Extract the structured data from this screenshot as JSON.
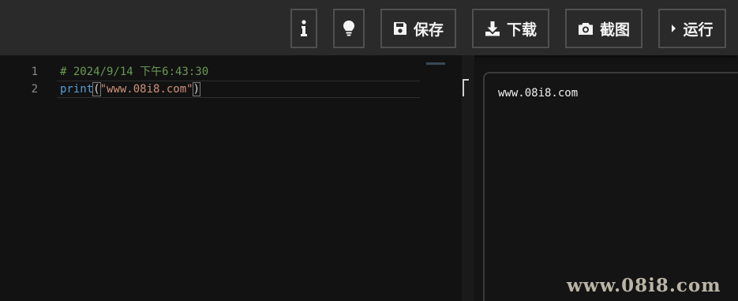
{
  "toolbar": {
    "info_icon": "info-icon",
    "hint_icon": "lightbulb-icon",
    "save_label": "保存",
    "download_label": "下载",
    "screenshot_label": "截图",
    "run_label": "运行"
  },
  "editor": {
    "lines": [
      {
        "number": "1",
        "comment": "# 2024/9/14 下午6:43:30"
      },
      {
        "number": "2",
        "fn": "print",
        "open": "(",
        "string": "\"www.08i8.com\"",
        "close": ")"
      }
    ]
  },
  "output": {
    "text": "www.08i8.com"
  },
  "watermark": "www.08i8.com",
  "colors": {
    "toolbar_bg": "#2a2a2a",
    "editor_bg": "#121212",
    "comment": "#6a9955",
    "function": "#569cd6",
    "string": "#ce9178"
  }
}
